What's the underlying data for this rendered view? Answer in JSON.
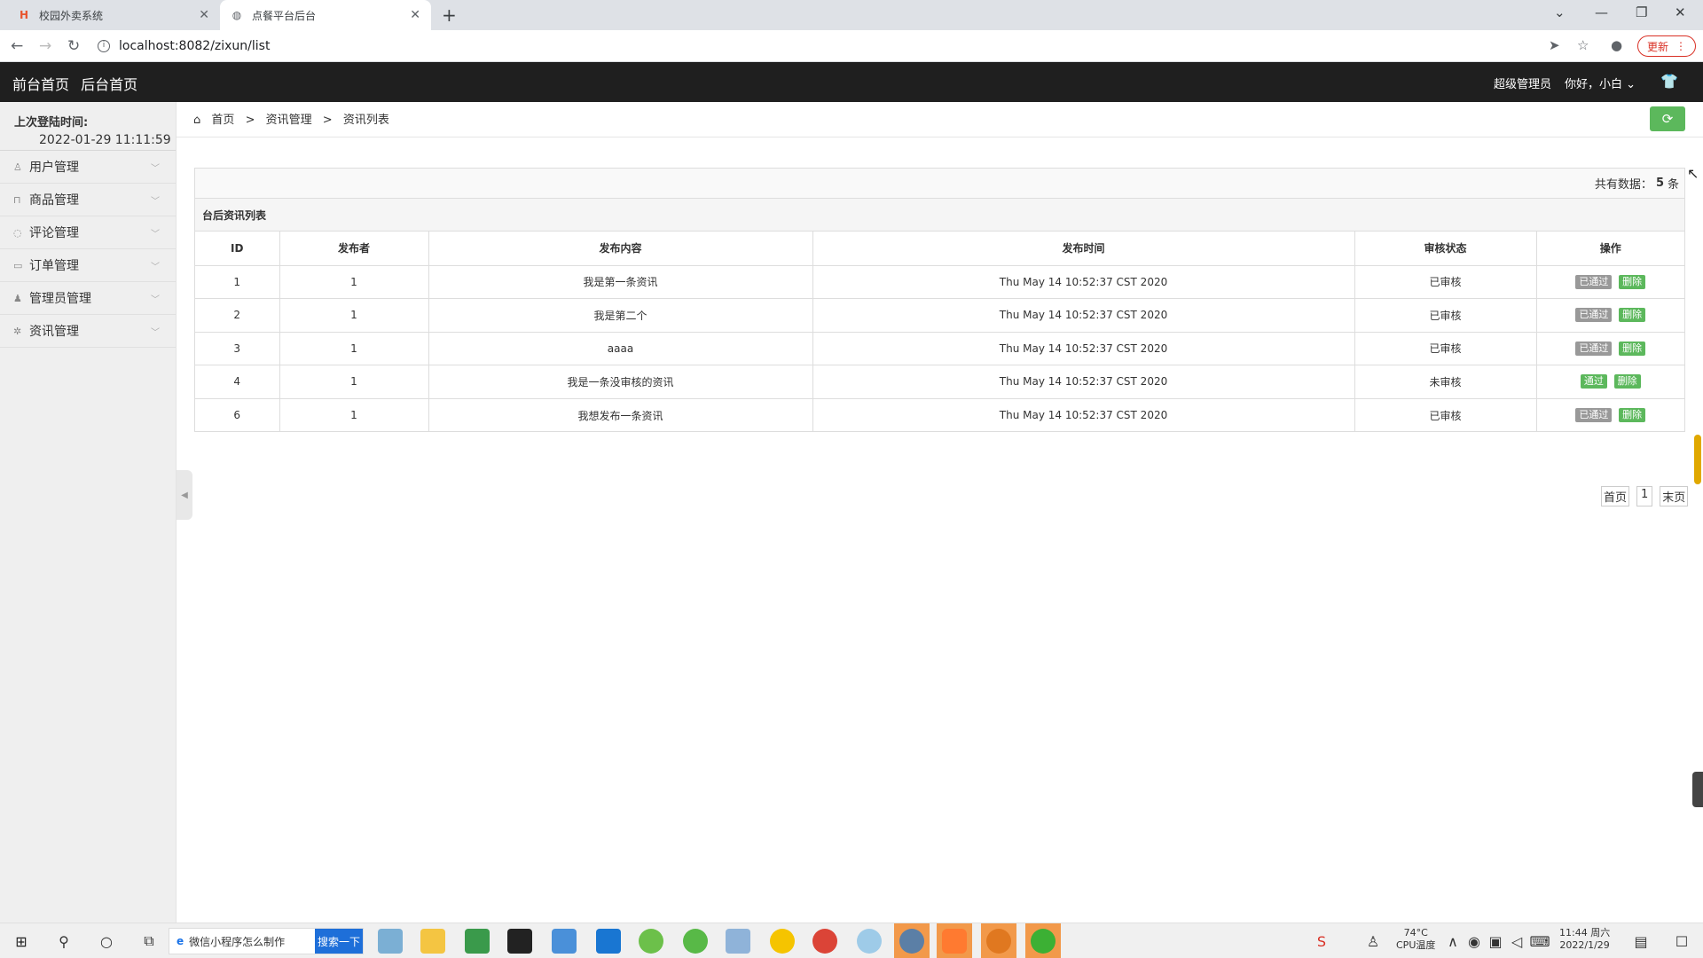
{
  "browser": {
    "tabs": [
      {
        "title": "校园外卖系统",
        "active": false
      },
      {
        "title": "点餐平台后台",
        "active": true
      }
    ],
    "url": "localhost:8082/zixun/list",
    "update_label": "更新"
  },
  "header": {
    "links": [
      "前台首页",
      "后台首页"
    ],
    "role": "超级管理员",
    "greeting": "你好，小白"
  },
  "sidebar": {
    "last_login_label": "上次登陆时间:",
    "last_login_time": "2022-01-29 11:11:59",
    "items": [
      {
        "label": "用户管理",
        "icon": "user-icon"
      },
      {
        "label": "商品管理",
        "icon": "bag-icon"
      },
      {
        "label": "评论管理",
        "icon": "comment-icon"
      },
      {
        "label": "订单管理",
        "icon": "card-icon"
      },
      {
        "label": "管理员管理",
        "icon": "admin-icon"
      },
      {
        "label": "资讯管理",
        "icon": "gear-icon"
      }
    ]
  },
  "breadcrumb": [
    "首页",
    "资讯管理",
    "资讯列表"
  ],
  "list": {
    "total_prefix": "共有数据：",
    "total_count": "5",
    "total_suffix": "条",
    "title": "台后资讯列表",
    "columns": [
      "ID",
      "发布者",
      "发布内容",
      "发布时间",
      "审核状态",
      "操作"
    ],
    "rows": [
      {
        "id": "1",
        "publisher": "1",
        "content": "我是第一条资讯",
        "time": "Thu May 14 10:52:37 CST 2020",
        "status": "已审核",
        "action1": "已通过",
        "action1_style": "gray",
        "action2": "删除"
      },
      {
        "id": "2",
        "publisher": "1",
        "content": "我是第二个",
        "time": "Thu May 14 10:52:37 CST 2020",
        "status": "已审核",
        "action1": "已通过",
        "action1_style": "gray",
        "action2": "删除"
      },
      {
        "id": "3",
        "publisher": "1",
        "content": "aaaa",
        "time": "Thu May 14 10:52:37 CST 2020",
        "status": "已审核",
        "action1": "已通过",
        "action1_style": "gray",
        "action2": "删除"
      },
      {
        "id": "4",
        "publisher": "1",
        "content": "我是一条没审核的资讯",
        "time": "Thu May 14 10:52:37 CST 2020",
        "status": "未审核",
        "action1": "通过",
        "action1_style": "green",
        "action2": "删除"
      },
      {
        "id": "6",
        "publisher": "1",
        "content": "我想发布一条资讯",
        "time": "Thu May 14 10:52:37 CST 2020",
        "status": "已审核",
        "action1": "已通过",
        "action1_style": "gray",
        "action2": "删除"
      }
    ]
  },
  "pager": {
    "first": "首页",
    "page": "1",
    "last": "末页"
  },
  "taskbar": {
    "search_text": "微信小程序怎么制作",
    "search_button": "搜索一下",
    "temp": "74°C",
    "temp_label": "CPU温度",
    "time": "11:44 周六",
    "date": "2022/1/29"
  },
  "colors": {
    "header_bg": "#1f1f1f",
    "accent_green": "#5cb85c",
    "sidebar_bg": "#efefef"
  }
}
